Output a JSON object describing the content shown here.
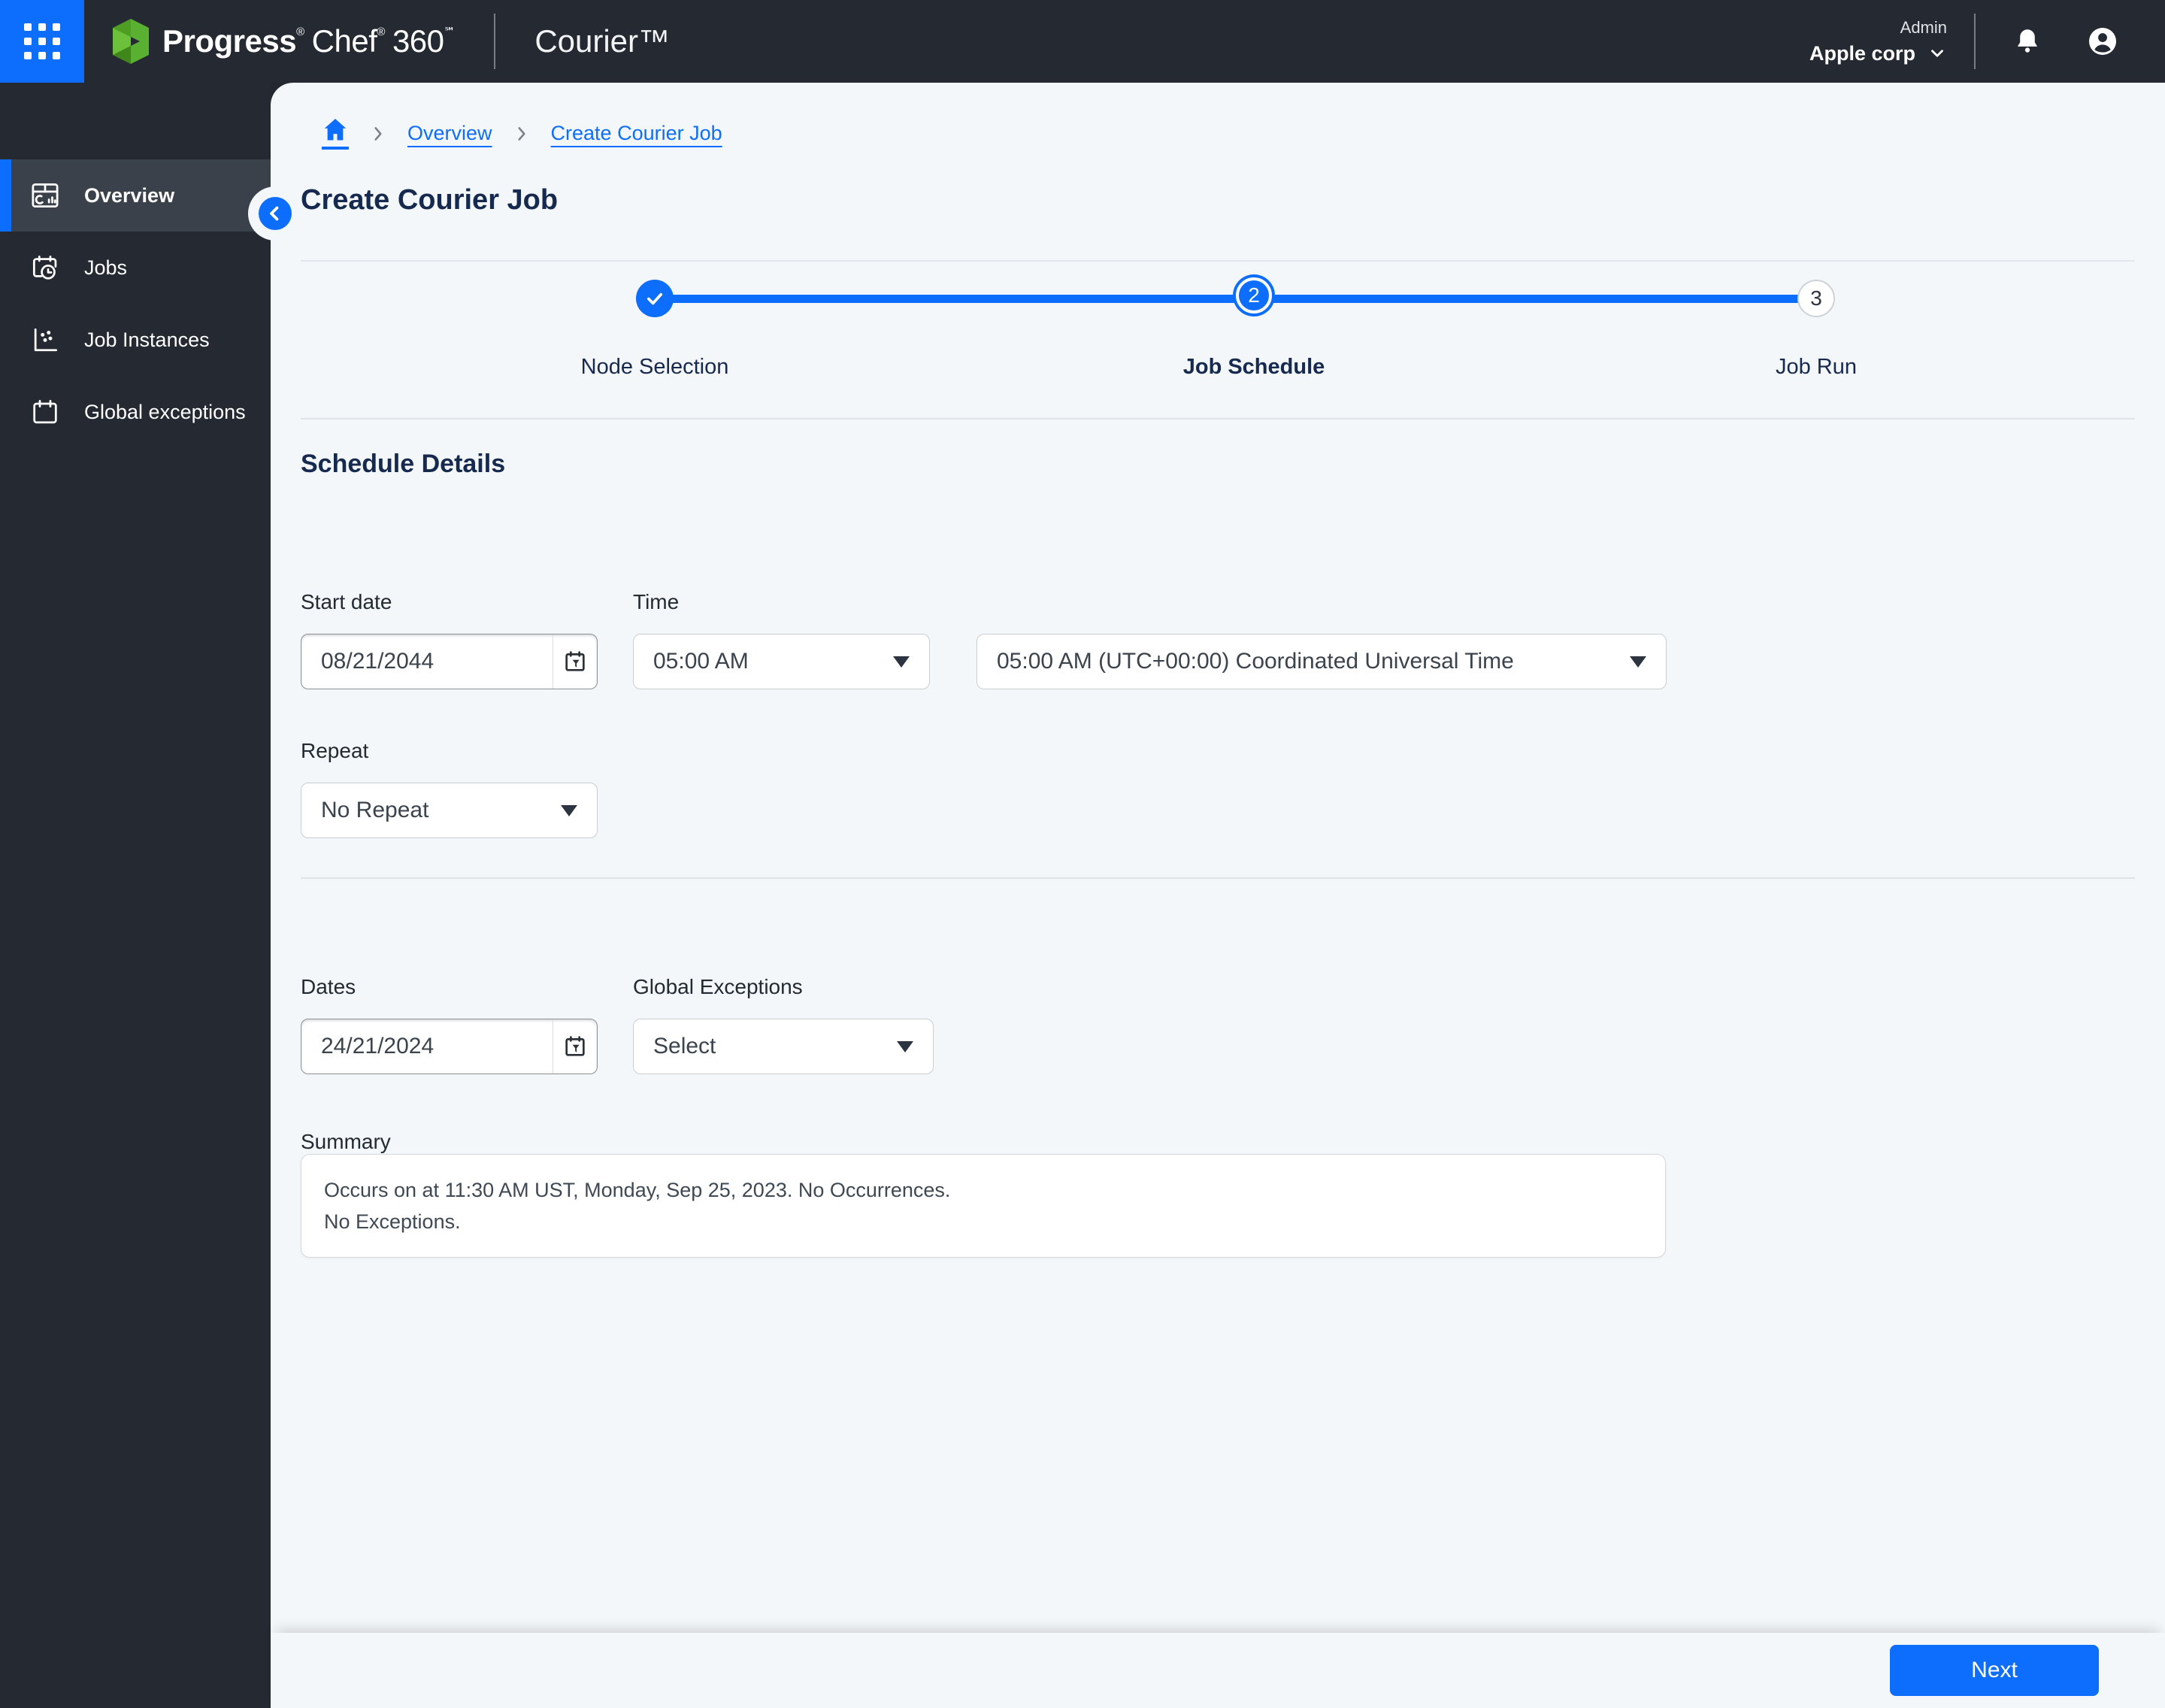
{
  "colors": {
    "accent": "#0d6efd",
    "header_bg": "#242932",
    "sidebar_active_bg": "#3a414a",
    "navy": "#16294f",
    "content_bg": "#f4f7f9"
  },
  "header": {
    "app_launcher_icon": "waffle-icon",
    "brand": {
      "word1": "Progress",
      "mark1": "®",
      "word2": "Chef",
      "mark2": "®",
      "word3": "360",
      "mark3": "℠"
    },
    "product": "Courier™",
    "role_label": "Admin",
    "org_name": "Apple corp",
    "icons": [
      "chevron-down-icon",
      "bell-icon",
      "account-icon"
    ]
  },
  "sidebar": {
    "items": [
      {
        "label": "Overview",
        "icon": "overview-icon",
        "active": true
      },
      {
        "label": "Jobs",
        "icon": "jobs-calendar-clock-icon",
        "active": false
      },
      {
        "label": "Job Instances",
        "icon": "scatter-plot-icon",
        "active": false
      },
      {
        "label": "Global exceptions",
        "icon": "calendar-icon",
        "active": false
      }
    ]
  },
  "breadcrumb": {
    "home_icon": "home-icon",
    "crumb1": "Overview",
    "crumb2": "Create Courier Job"
  },
  "page": {
    "title": "Create Courier Job"
  },
  "stepper": {
    "steps": [
      {
        "number": "",
        "label": "Node Selection",
        "state": "complete",
        "icon": "check-icon"
      },
      {
        "number": "2",
        "label": "Job Schedule",
        "state": "active"
      },
      {
        "number": "3",
        "label": "Job Run",
        "state": "upcoming"
      }
    ]
  },
  "form": {
    "section_title": "Schedule Details",
    "start_date": {
      "label": "Start date",
      "value": "08/21/2044",
      "icon": "calendar-picker-icon"
    },
    "time": {
      "label": "Time",
      "value": "05:00 AM"
    },
    "timezone": {
      "value": "05:00 AM (UTC+00:00) Coordinated Universal Time"
    },
    "repeat": {
      "label": "Repeat",
      "value": "No Repeat"
    },
    "dates": {
      "label": "Dates",
      "value": "24/21/2024",
      "icon": "calendar-picker-icon"
    },
    "global_exceptions": {
      "label": "Global Exceptions",
      "value": "Select"
    },
    "summary": {
      "label": "Summary",
      "line1": "Occurs on at 11:30 AM UST, Monday, Sep 25, 2023. No Occurrences.",
      "line2": "No Exceptions."
    }
  },
  "footer": {
    "next_label": "Next"
  }
}
